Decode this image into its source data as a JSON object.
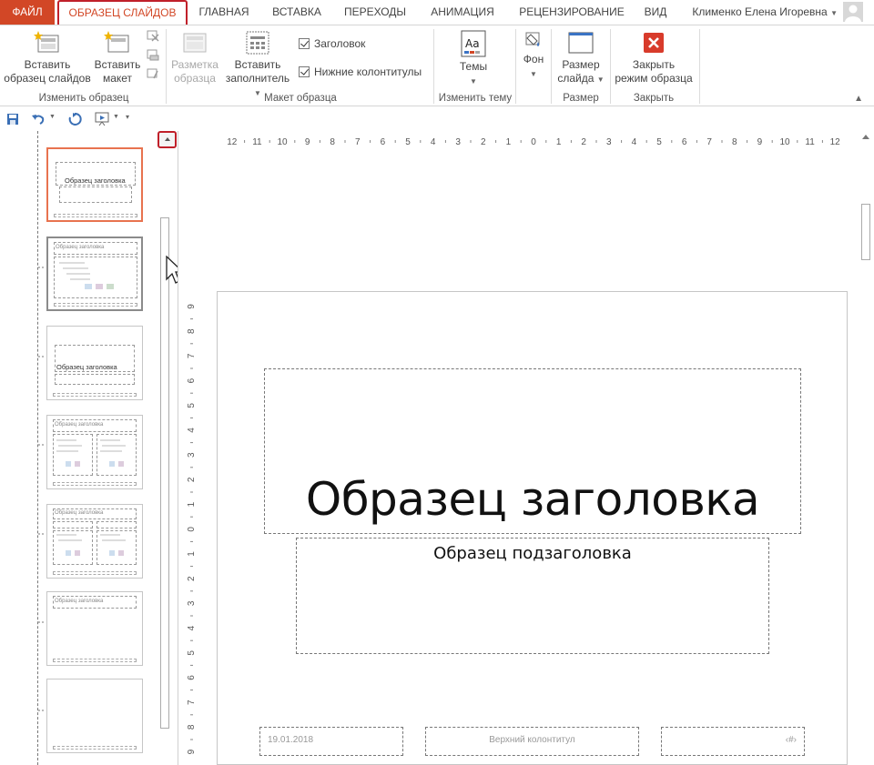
{
  "tabs": {
    "file": "ФАЙЛ",
    "slide_master": "ОБРАЗЕЦ СЛАЙДОВ",
    "home": "ГЛАВНАЯ",
    "insert": "ВСТАВКА",
    "transitions": "ПЕРЕХОДЫ",
    "animation": "АНИМАЦИЯ",
    "review": "РЕЦЕНЗИРОВАНИЕ",
    "view": "ВИД"
  },
  "user": {
    "name": "Клименко Елена Игоревна"
  },
  "ribbon": {
    "insert_master_line1": "Вставить",
    "insert_master_line2": "образец слайдов",
    "insert_layout_line1": "Вставить",
    "insert_layout_line2": "макет",
    "group_edit_master": "Изменить образец",
    "master_layout_line1": "Разметка",
    "master_layout_line2": "образца",
    "insert_placeholder_line1": "Вставить",
    "insert_placeholder_line2": "заполнитель",
    "title_checkbox": "Заголовок",
    "footers_checkbox": "Нижние колонтитулы",
    "group_master_layout": "Макет образца",
    "themes": "Темы",
    "group_edit_theme": "Изменить тему",
    "background": "Фон",
    "slide_size_line1": "Размер",
    "slide_size_line2": "слайда",
    "group_size": "Размер",
    "close_master_line1": "Закрыть",
    "close_master_line2": "режим образца",
    "group_close": "Закрыть"
  },
  "ruler": {
    "horizontal": [
      "12",
      "11",
      "10",
      "9",
      "8",
      "7",
      "6",
      "5",
      "4",
      "3",
      "2",
      "1",
      "0",
      "1",
      "2",
      "3",
      "4",
      "5",
      "6",
      "7",
      "8",
      "9",
      "10",
      "11",
      "12"
    ],
    "vertical": [
      "9",
      "8",
      "7",
      "6",
      "5",
      "4",
      "3",
      "2",
      "1",
      "0",
      "1",
      "2",
      "3",
      "4",
      "5",
      "6",
      "7",
      "8",
      "9"
    ]
  },
  "thumbnails": [
    {
      "kind": "title",
      "title": "Образец заголовка"
    },
    {
      "kind": "content",
      "title": "Образец заголовка"
    },
    {
      "kind": "section",
      "title": "Образец заголовка"
    },
    {
      "kind": "two",
      "title": "Образец заголовка"
    },
    {
      "kind": "compare",
      "title": "Образец заголовка"
    },
    {
      "kind": "titleonly",
      "title": "Образец заголовка"
    },
    {
      "kind": "blank",
      "title": ""
    }
  ],
  "slide": {
    "title": "Образец заголовка",
    "subtitle": "Образец подзаголовка",
    "date": "19.01.2018",
    "footer": "Верхний колонтитул",
    "slide_number": "‹#›"
  },
  "colors": {
    "accent": "#d24726",
    "annotation": "#c0202a"
  }
}
